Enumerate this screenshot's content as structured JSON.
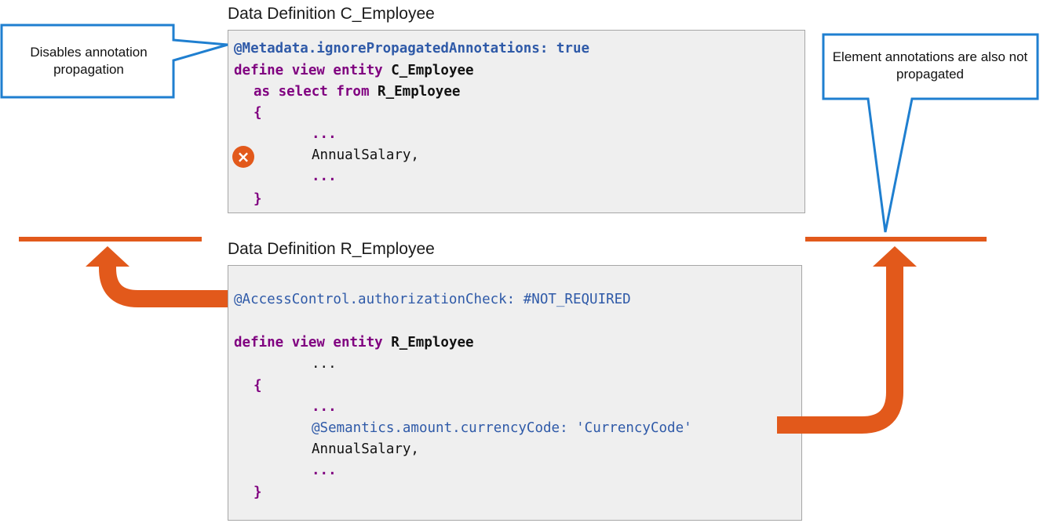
{
  "top": {
    "title": "Data Definition C_Employee",
    "lines": {
      "l1": "@Metadata.ignorePropagatedAnnotations: true",
      "l2_kw": "define view entity ",
      "l2_id": "C_Employee",
      "l3_kw": "as select from ",
      "l3_id": "R_Employee",
      "l4": "{",
      "l5": "...",
      "l6": "AnnualSalary,",
      "l7": "...",
      "l8": "}"
    },
    "error_icon": "close-icon"
  },
  "bottom": {
    "title": "Data Definition R_Employee",
    "lines": {
      "l1": "@AccessControl.authorizationCheck: #NOT_REQUIRED",
      "l2_kw": "define view entity ",
      "l2_id": "R_Employee",
      "l3": "...",
      "l4": "{",
      "l5": "...",
      "l6": "@Semantics.amount.currencyCode: 'CurrencyCode'",
      "l7": "AnnualSalary,",
      "l8": "...",
      "l9": "}"
    }
  },
  "callouts": {
    "left": "Disables annotation propagation",
    "right": "Element annotations are also not propagated"
  },
  "colors": {
    "accent_orange": "#e2591b",
    "callout_border": "#1f7fd0",
    "annotation_blue": "#2f5aa8",
    "keyword_purple": "#800080"
  }
}
